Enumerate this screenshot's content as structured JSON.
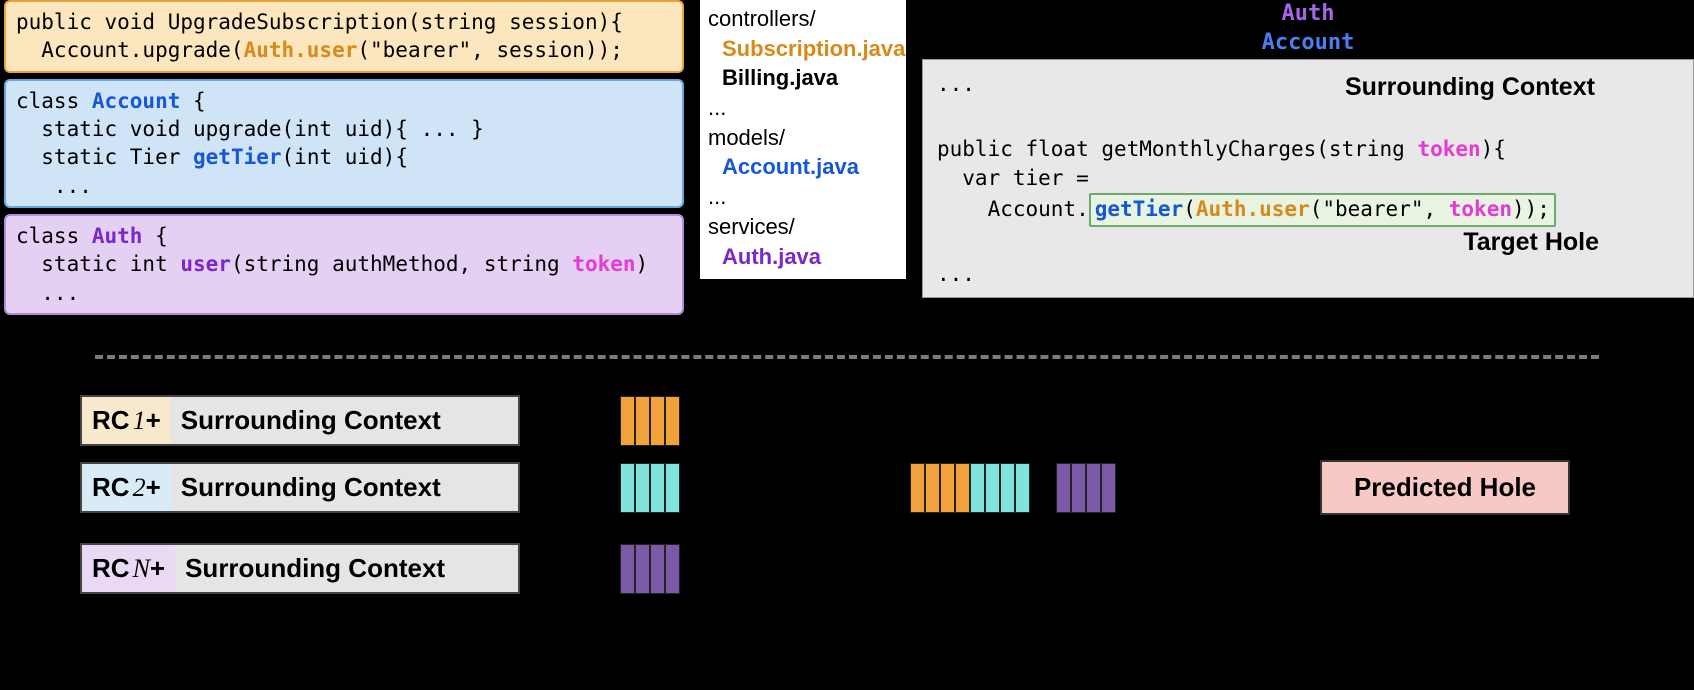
{
  "code_orange": {
    "l1a": "public void UpgradeSubscription(string session){",
    "l2a": "  Account.upgrade(",
    "l2b": "Auth.user",
    "l2c": "(\"bearer\", session));"
  },
  "code_blue": {
    "l1a": "class ",
    "l1b": "Account",
    "l1c": " {",
    "l2": "  static void upgrade(int uid){ ... }",
    "l3a": "  static Tier ",
    "l3b": "getTier",
    "l3c": "(int uid){",
    "l4": "   ..."
  },
  "code_purple": {
    "l1a": "class ",
    "l1b": "Auth",
    "l1c": " {",
    "l2a": "  static int ",
    "l2b": "user",
    "l2c": "(string authMethod, string ",
    "l2d": "token",
    "l2e": ")",
    "l3": "  ..."
  },
  "files": {
    "d1": "controllers/",
    "f1": "Subscription.java",
    "f2": "Billing.java",
    "e1": "...",
    "d2": "models/",
    "f3": "Account.java",
    "e2": "...",
    "d3": "services/",
    "f4": "Auth.java"
  },
  "imports": {
    "auth": "Auth",
    "acct": "Account"
  },
  "ctx": {
    "header": "Surrounding Context",
    "dots1": "...",
    "l1a": "public float getMonthlyCharges(string ",
    "l1b": "token",
    "l1c": "){",
    "l2": "  var tier =",
    "l3a": "    Account.",
    "hole_a": "getTier",
    "hole_b": "(",
    "hole_c": "Auth.user",
    "hole_d": "(\"bearer\", ",
    "hole_e": "token",
    "hole_f": "));",
    "target": "Target Hole",
    "dots2": "..."
  },
  "rc": {
    "rc1": "RC",
    "n1": "1",
    "plus": " + ",
    "sc": "Surrounding Context",
    "n2": "2",
    "nn": "N"
  },
  "predicted": "Predicted Hole",
  "chart_data": {
    "type": "diagram",
    "title": "Repository-level code completion: retrieved contexts (RC) + surrounding context encoded and fused to predict target hole",
    "components": [
      "Three retrieved code snippets (Subscription.java / Account.java / Auth.java)",
      "Repository file tree",
      "Surrounding context with target hole in Billing.java (getMonthlyCharges)",
      "N pills: RC i + Surrounding Context",
      "Per-RC token encodings (orange / teal / purple blocks)",
      "Fused encoding (concatenated orange+teal+purple)",
      "Predicted Hole output"
    ]
  }
}
